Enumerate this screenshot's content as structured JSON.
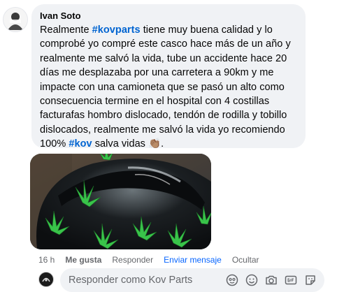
{
  "comment": {
    "author": "Ivan Soto",
    "text_parts": [
      "Realmente ",
      "#kovparts",
      " tiene muy buena calidad y lo comprobé yo compré este casco hace más de un año y realmente me salvó la vida, tube un accidente hace 20 días me desplazaba por una carretera a 90km y me impacte con una camioneta que se pasó un alto como consecuencia termine en el hospital con 4 costillas facturafas hombro dislocado, tendón de rodilla y tobillo dislocados, realmente me salvó la vida yo recomiendo 100% ",
      "#kov",
      " salva vidas ",
      "👏🏽",
      "."
    ]
  },
  "actions": {
    "time": "16 h",
    "like": "Me gusta",
    "reply": "Responder",
    "send_message": "Enviar mensaje",
    "hide": "Ocultar"
  },
  "reply_box": {
    "placeholder": "Responder como Kov Parts"
  },
  "icons": [
    "avatar-photo-icon",
    "emoji-icon",
    "avatar-sticker-icon",
    "camera-icon",
    "gif-icon",
    "sticker-icon"
  ],
  "colors": {
    "bubble_bg": "#f0f2f5",
    "hashtag": "#0064d1",
    "link_blue": "#0866ff",
    "muted": "#65676b"
  }
}
